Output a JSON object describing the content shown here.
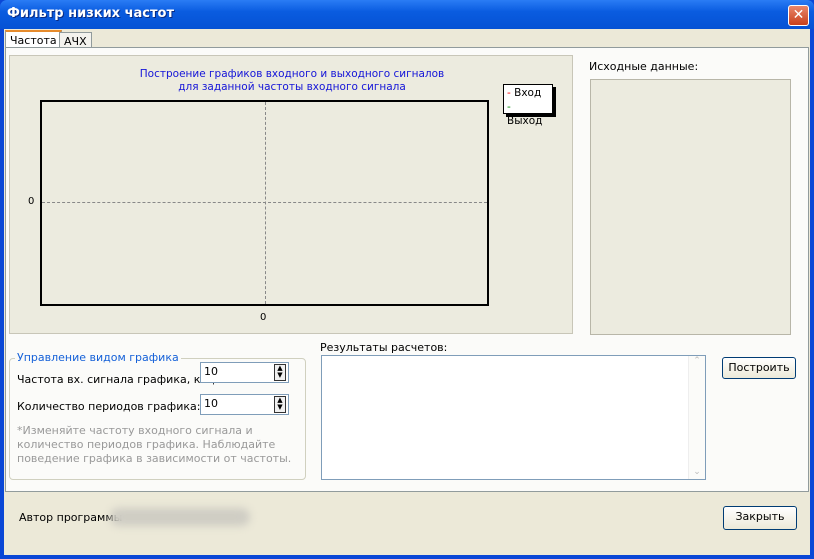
{
  "window": {
    "title": "Фильтр низких частот",
    "close_icon": "close-icon"
  },
  "tabs": [
    {
      "label": "Частота",
      "active": true
    },
    {
      "label": "АЧХ",
      "active": false
    }
  ],
  "chart": {
    "title_line1": "Построение графиков  входного и выходного сигналов",
    "title_line2": "для заданной частоты входного сигнала",
    "y_tick": "0",
    "x_tick": "0",
    "legend": [
      {
        "label": "Вход",
        "color": "#ff0000"
      },
      {
        "label": "Выход",
        "color": "#008000"
      }
    ]
  },
  "source": {
    "label": "Исходные данные:"
  },
  "controls": {
    "group_title": "Управление видом графика",
    "freq_label": "Частота вх. сигнала графика, кГц:",
    "freq_value": "10",
    "periods_label": "Количество периодов графика:",
    "periods_value": "10",
    "hint": "*Изменяйте частоту входного сигнала и количество периодов графика. Наблюдайте поведение графика в зависимости от частоты."
  },
  "results": {
    "label": "Результаты расчетов:",
    "value": ""
  },
  "buttons": {
    "build": "Построить",
    "close": "Закрыть"
  },
  "footer": {
    "author_label": "Автор программы"
  }
}
